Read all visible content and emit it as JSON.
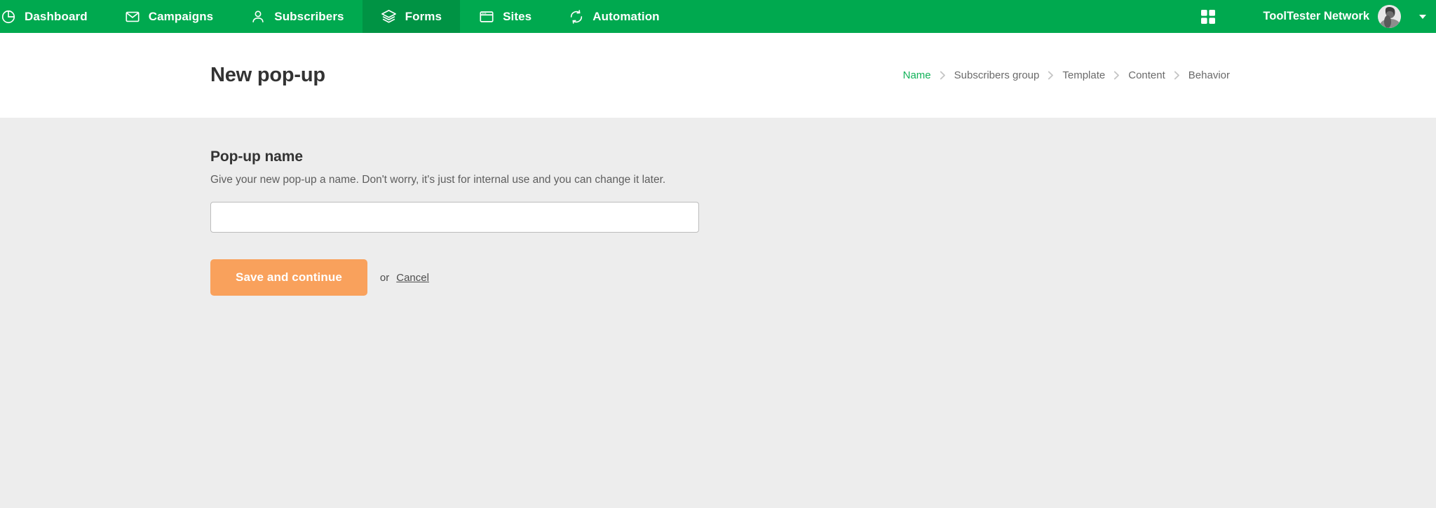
{
  "colors": {
    "nav_green": "#00a94f",
    "nav_active_green": "#009344",
    "breadcrumb_active": "#12b259",
    "button_orange": "#f9a15c",
    "body_gray": "#ededed"
  },
  "topnav": {
    "items": [
      {
        "label": "Dashboard",
        "icon": "pie-chart-icon",
        "active": false
      },
      {
        "label": "Campaigns",
        "icon": "envelope-icon",
        "active": false
      },
      {
        "label": "Subscribers",
        "icon": "person-icon",
        "active": false
      },
      {
        "label": "Forms",
        "icon": "layers-icon",
        "active": true
      },
      {
        "label": "Sites",
        "icon": "browser-window-icon",
        "active": false
      },
      {
        "label": "Automation",
        "icon": "refresh-cycle-icon",
        "active": false
      }
    ],
    "apps_icon": "grid-apps-icon",
    "account_name": "ToolTester Network",
    "avatar_icon": "user-avatar-photo",
    "caret_icon": "chevron-down-icon"
  },
  "subheader": {
    "title": "New pop-up",
    "breadcrumb": [
      {
        "label": "Name",
        "active": true
      },
      {
        "label": "Subscribers group",
        "active": false
      },
      {
        "label": "Template",
        "active": false
      },
      {
        "label": "Content",
        "active": false
      },
      {
        "label": "Behavior",
        "active": false
      }
    ]
  },
  "main": {
    "section_title": "Pop-up name",
    "section_desc": "Give your new pop-up a name. Don't worry, it's just for internal use and you can change it later.",
    "name_input": {
      "value": "",
      "placeholder": ""
    },
    "save_label": "Save and continue",
    "or_label": "or",
    "cancel_label": "Cancel"
  }
}
